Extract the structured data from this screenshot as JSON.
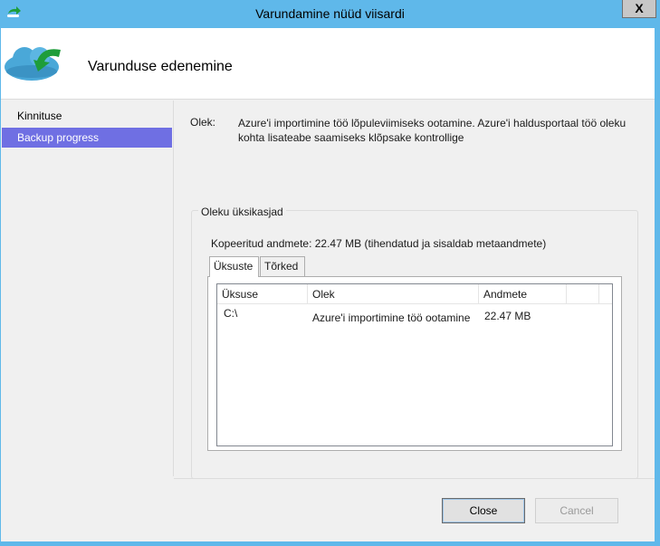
{
  "window": {
    "title": "Varundamine nüüd viisardi",
    "close_glyph": "X"
  },
  "header": {
    "title": "Varunduse edenemine",
    "icon": "cloud-backup-icon"
  },
  "nav": {
    "items": [
      {
        "label": "Kinnituse",
        "selected": false
      },
      {
        "label": "Backup progress",
        "selected": true
      }
    ]
  },
  "status": {
    "label": "Olek:",
    "text": "Azure'i importimine töö lõpuleviimiseks ootamine. Azure'i haldusportaal töö oleku kohta lisateabe saamiseks klõpsake kontrollige"
  },
  "details": {
    "group_title": "Oleku üksikasjad",
    "copied": "Kopeeritud andmete: 22.47 MB (tihendatud ja sisaldab metaandmete)",
    "tabs": [
      {
        "label": "Üksuste",
        "active": true
      },
      {
        "label": "Tõrked",
        "active": false
      }
    ],
    "columns": [
      "Üksuse",
      "Olek",
      "Andmete"
    ],
    "rows": [
      {
        "item": "C:\\",
        "status": "Azure'i importimine töö ootamine",
        "data": "22.47 MB"
      }
    ]
  },
  "buttons": {
    "close": "Close",
    "cancel": "Cancel"
  },
  "colors": {
    "titlebar": "#5fb8ea",
    "nav_selected": "#6f6fe3",
    "icon_green": "#1e9d3a"
  }
}
